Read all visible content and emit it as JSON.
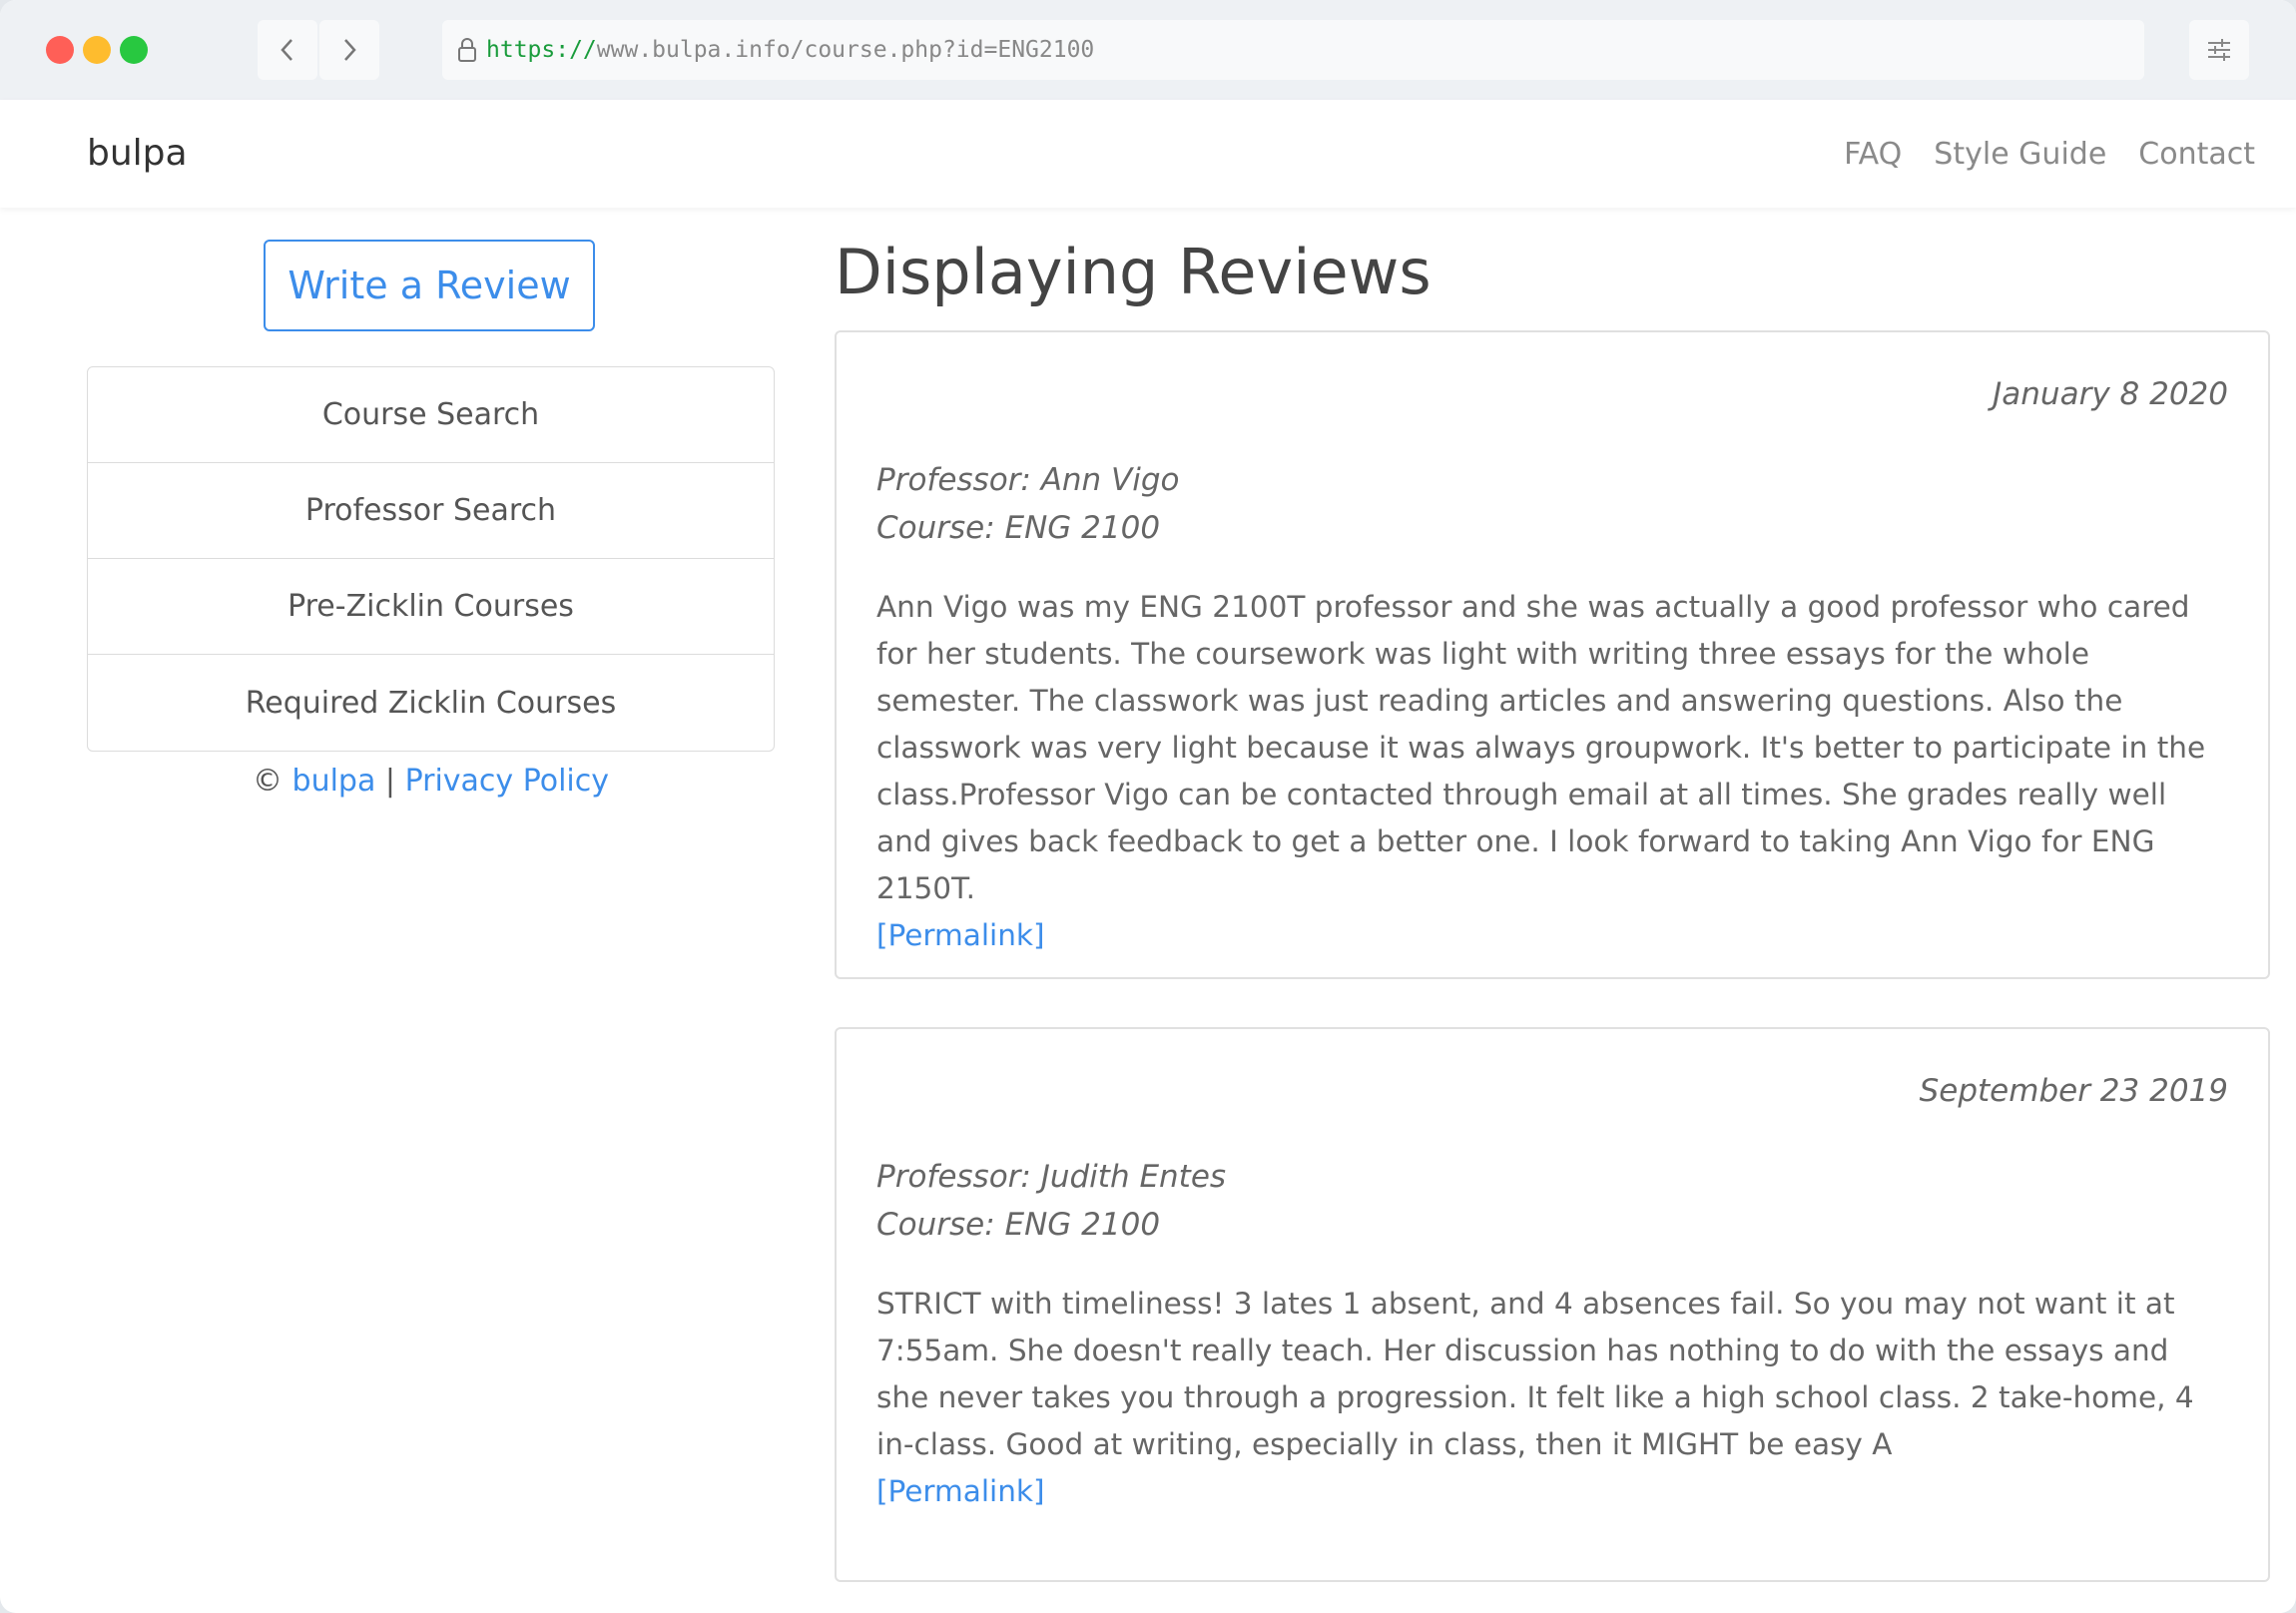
{
  "browser": {
    "url_scheme": "https://",
    "url_rest": "www.bulpa.info/course.php?id=ENG2100"
  },
  "navbar": {
    "brand": "bulpa",
    "links": [
      "FAQ",
      "Style Guide",
      "Contact"
    ]
  },
  "sidebar": {
    "write_review": "Write a Review",
    "items": [
      "Course Search",
      "Professor Search",
      "Pre-Zicklin Courses",
      "Required Zicklin Courses"
    ],
    "footer": {
      "copyright": "©",
      "site_link": "bulpa",
      "separator": "|",
      "privacy_link": "Privacy Policy"
    }
  },
  "main": {
    "heading": "Displaying Reviews",
    "reviews": [
      {
        "date": "January 8 2020",
        "professor": "Professor: Ann Vigo",
        "course": "Course: ENG 2100",
        "text": "Ann Vigo was my ENG 2100T professor and she was actually a good professor who cared for her students. The coursework was light with writing three essays for the whole semester. The classwork was just reading articles and answering questions. Also the classwork was very light because it was always groupwork. It's better to participate in the class.Professor Vigo can be contacted through email at all times. She grades really well and gives back feedback to get a better one. I look forward to taking Ann Vigo for ENG 2150T.",
        "permalink": "[Permalink]"
      },
      {
        "date": "September 23 2019",
        "professor": "Professor: Judith Entes",
        "course": "Course: ENG 2100",
        "text": "STRICT with timeliness! 3 lates 1 absent, and 4 absences fail. So you may not want it at 7:55am. She doesn't really teach. Her discussion has nothing to do with the essays and she never takes you through a progression. It felt like a high school class. 2 take-home, 4 in-class. Good at writing, especially in class, then it MIGHT be easy A",
        "permalink": "[Permalink]"
      }
    ]
  },
  "colors": {
    "accent": "#3c8dea",
    "url_scheme": "#1a9c3c"
  }
}
